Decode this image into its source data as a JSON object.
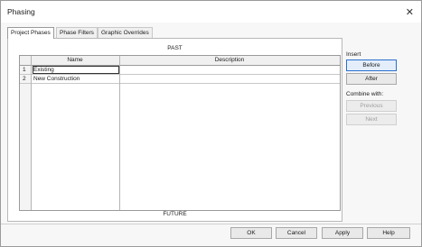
{
  "window": {
    "title": "Phasing"
  },
  "tabs": [
    {
      "label": "Project Phases"
    },
    {
      "label": "Phase Filters"
    },
    {
      "label": "Graphic Overrides"
    }
  ],
  "panel": {
    "past_label": "PAST",
    "future_label": "FUTURE"
  },
  "grid": {
    "columns": [
      "Name",
      "Description"
    ],
    "rows": [
      {
        "num": "1",
        "name": "Existing",
        "description": ""
      },
      {
        "num": "2",
        "name": "New Construction",
        "description": ""
      }
    ]
  },
  "insert": {
    "label": "Insert",
    "before": "Before",
    "after": "After"
  },
  "combine": {
    "label": "Combine with:",
    "previous": "Previous",
    "next": "Next"
  },
  "footer": {
    "ok": "OK",
    "cancel": "Cancel",
    "apply": "Apply",
    "help": "Help"
  },
  "icons": {
    "close": "close-icon"
  }
}
